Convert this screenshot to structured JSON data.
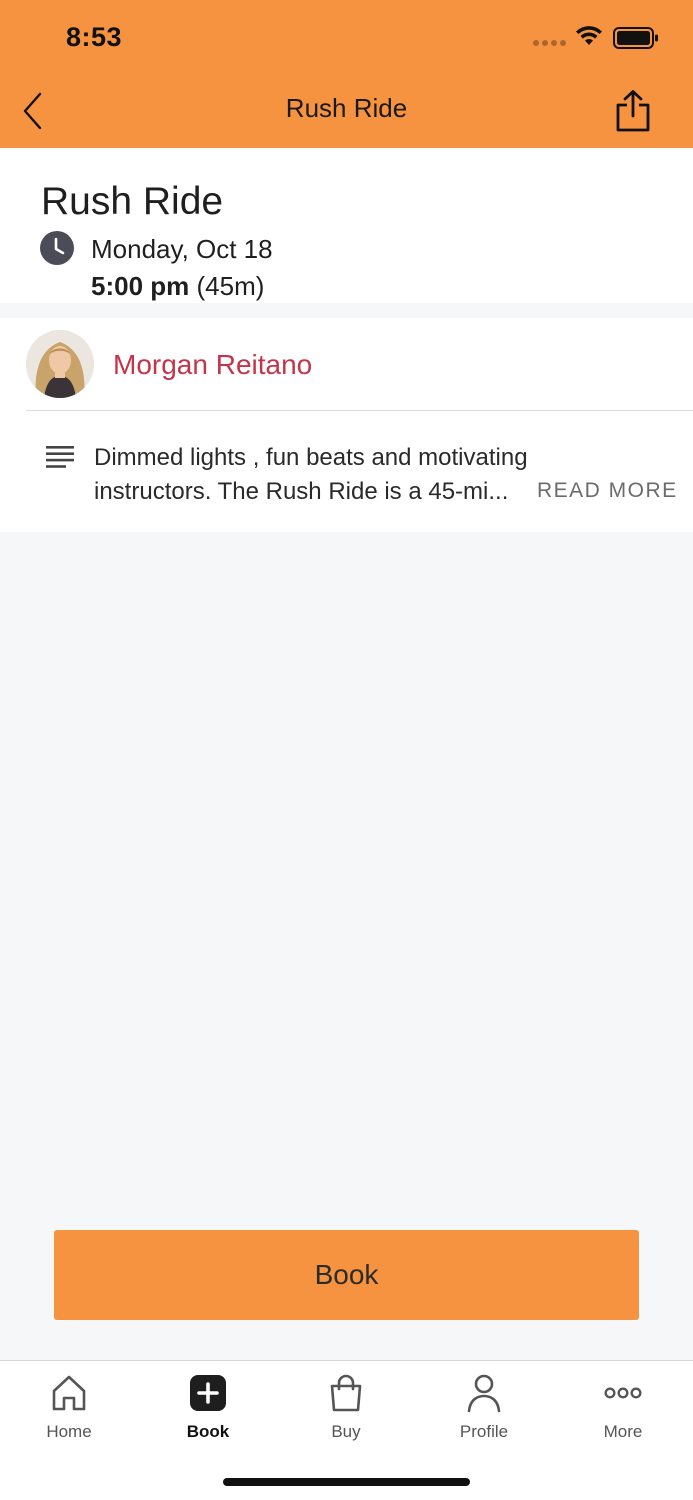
{
  "status_bar": {
    "time": "8:53"
  },
  "nav": {
    "title": "Rush Ride"
  },
  "class_info": {
    "title": "Rush Ride",
    "date": "Monday, Oct 18",
    "start_time": "5:00 pm",
    "duration": "(45m)"
  },
  "instructor": {
    "name": "Morgan Reitano"
  },
  "description": {
    "line1": "Dimmed lights , fun beats and motivating",
    "line2": "instructors. The Rush Ride is a 45-mi...",
    "read_more": "READ MORE"
  },
  "book_button": {
    "label": "Book"
  },
  "tabbar": {
    "items": [
      {
        "label": "Home",
        "icon": "home-icon",
        "active": false
      },
      {
        "label": "Book",
        "icon": "plus-square-icon",
        "active": true
      },
      {
        "label": "Buy",
        "icon": "shopping-bag-icon",
        "active": false
      },
      {
        "label": "Profile",
        "icon": "person-icon",
        "active": false
      },
      {
        "label": "More",
        "icon": "more-dots-icon",
        "active": false
      }
    ]
  },
  "colors": {
    "accent": "#f69340",
    "instructor_link": "#c4344a",
    "background": "#f6f7f9"
  }
}
